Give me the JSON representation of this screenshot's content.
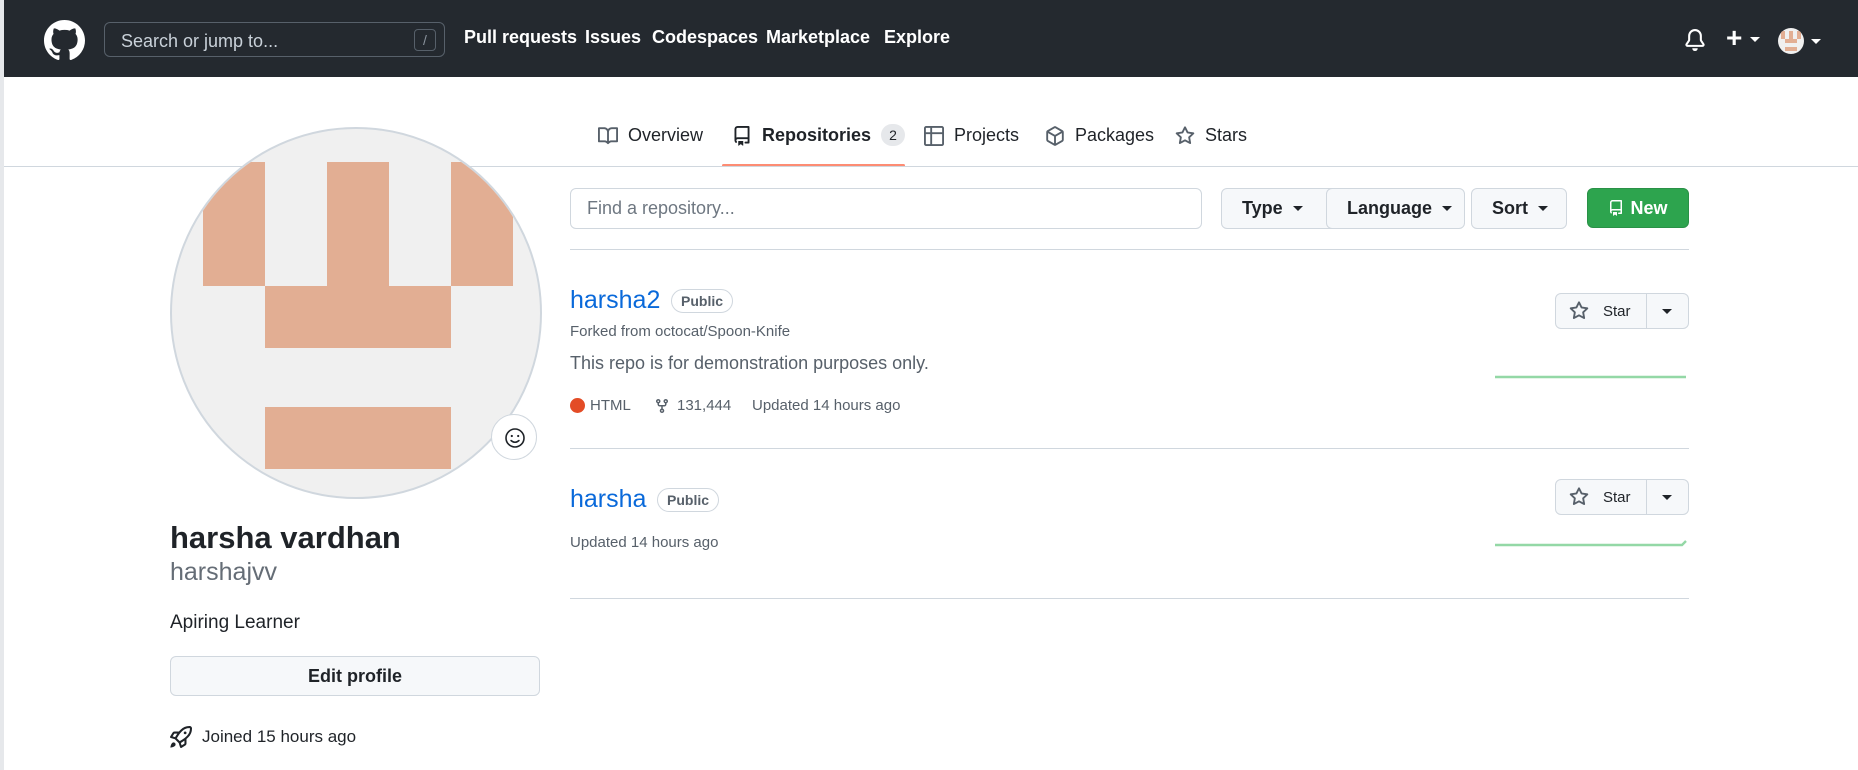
{
  "header": {
    "search_placeholder": "Search or jump to...",
    "search_shortcut": "/",
    "nav": [
      "Pull requests",
      "Issues",
      "Codespaces",
      "Marketplace",
      "Explore"
    ],
    "icons": [
      "github-logo-icon",
      "bell-icon",
      "plus-icon",
      "avatar"
    ]
  },
  "tabs": [
    {
      "label": "Overview",
      "icon": "book-icon"
    },
    {
      "label": "Repositories",
      "icon": "repo-icon",
      "count": "2",
      "selected": true
    },
    {
      "label": "Projects",
      "icon": "table-icon"
    },
    {
      "label": "Packages",
      "icon": "package-icon"
    },
    {
      "label": "Stars",
      "icon": "star-icon"
    }
  ],
  "profile": {
    "name": "harsha vardhan",
    "login": "harshajvv",
    "bio": "Apiring Learner",
    "edit_label": "Edit profile",
    "joined": "Joined 15 hours ago"
  },
  "controls": {
    "find_placeholder": "Find a repository...",
    "type_label": "Type",
    "language_label": "Language",
    "sort_label": "Sort",
    "new_label": "New"
  },
  "repos": [
    {
      "name": "harsha2",
      "visibility": "Public",
      "forked_from": "Forked from octocat/Spoon-Knife",
      "description": "This repo is for demonstration purposes only.",
      "language": "HTML",
      "language_color": "#e34c26",
      "forks": "131,444",
      "updated": "Updated 14 hours ago",
      "star_label": "Star"
    },
    {
      "name": "harsha",
      "visibility": "Public",
      "updated": "Updated 14 hours ago",
      "star_label": "Star"
    }
  ],
  "colors": {
    "header_bg": "#24292f",
    "link": "#0969da",
    "new_button": "#2da44e",
    "tab_underline": "#fd8c73",
    "avatar_identicon": "#e2ae93"
  }
}
